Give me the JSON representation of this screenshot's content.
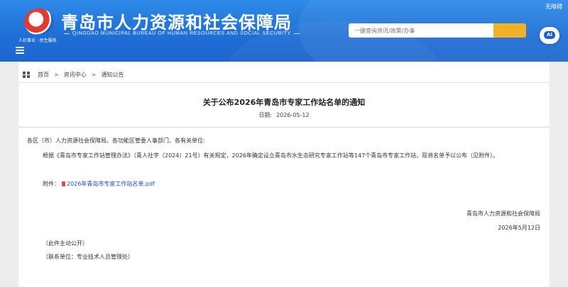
{
  "header": {
    "site_title": "青岛市人力资源和社会保障局",
    "site_subtitle": "QINGDAO MUNICIPAL BUREAU OF HUMAN RESOURCES AND SOCIAL SECURITY",
    "logo_caption": "人社事业 · 民生服务",
    "accessibility_label": "无障碍",
    "search_placeholder": "一键查询资讯/政策/办事",
    "robot_label": "AI",
    "brand_color": "#1f6fd6",
    "accent_color": "#f3b223"
  },
  "breadcrumb": {
    "items": [
      "首页",
      "资讯中心",
      "通知公告"
    ],
    "separator": ">"
  },
  "article": {
    "title": "关于公布2026年青岛市专家工作站名单的通知",
    "date_label": "日期:",
    "date": "2026-05-12",
    "salutation": "各区（市）人力资源社会保障局、各功能区管委人事部门、各有关单位:",
    "paragraph": "根据《青岛市专家工作站管理办法》（青人社字〔2024〕21号）有关规定，2026年确定设立青岛市水生态研究专家工作站等147个青岛市专家工作站，现将名单予以公布（见附件）。",
    "attachment_label": "附件：",
    "attachment_name": "2026年青岛市专家工作站名单.pdf",
    "signature_org": "青岛市人力资源和社会保障局",
    "signature_date": "2026年5月12日",
    "note_public": "（此件主动公开）",
    "note_contact": "（联系单位：专业技术人员管理处）"
  },
  "icons": {
    "menu": "menu-icon",
    "home": "home-icon",
    "pdf": "pdf-icon",
    "robot": "robot-icon"
  }
}
